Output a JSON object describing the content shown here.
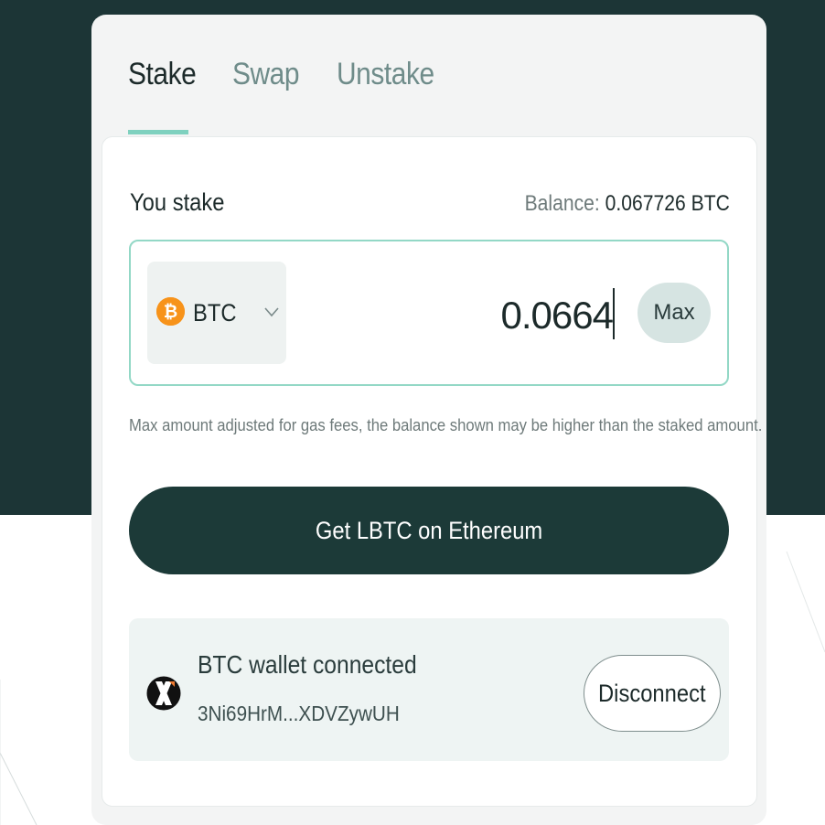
{
  "tabs": [
    {
      "label": "Stake",
      "active": true
    },
    {
      "label": "Swap",
      "active": false
    },
    {
      "label": "Unstake",
      "active": false
    }
  ],
  "stake_form": {
    "heading": "You stake",
    "balance_label": "Balance:",
    "balance_value": "0.067726 BTC",
    "token_symbol": "BTC",
    "token_icon": "bitcoin-icon",
    "amount": "0.0664",
    "max_label": "Max",
    "note": "Max amount adjusted for gas fees, the balance shown may be higher than the staked amount.",
    "cta_label": "Get LBTC on Ethereum"
  },
  "wallet": {
    "status": "BTC wallet connected",
    "address": "3Ni69HrM...XDVZywUH",
    "icon": "xverse-wallet-icon",
    "disconnect_label": "Disconnect"
  },
  "colors": {
    "background_dark": "#1c3536",
    "accent": "#7fd1bf",
    "cta_background": "#1c3a38",
    "bitcoin_orange": "#f7931a"
  }
}
